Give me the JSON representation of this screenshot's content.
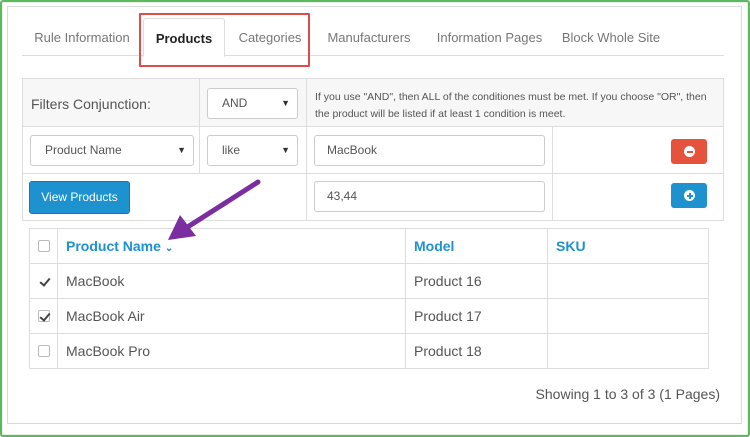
{
  "tabs": [
    {
      "label": "Rule Information",
      "active": false
    },
    {
      "label": "Products",
      "active": true
    },
    {
      "label": "Categories",
      "active": false
    },
    {
      "label": "Manufacturers",
      "active": false
    },
    {
      "label": "Information Pages",
      "active": false
    },
    {
      "label": "Block Whole Site",
      "active": false
    }
  ],
  "filters": {
    "conjunction_label": "Filters Conjunction:",
    "conjunction_value": "AND",
    "help_text": "If you use \"AND\", then ALL of the conditiones must be met. If you choose \"OR\", then the product will be listed if at least 1 condition is meet.",
    "field_value": "Product Name",
    "operator_value": "like",
    "value_input": "MacBook",
    "view_button": "View Products",
    "ids_input": "43,44"
  },
  "table": {
    "columns": [
      "Product Name",
      "Model",
      "SKU"
    ],
    "sort_column": "Product Name",
    "rows": [
      {
        "name": "MacBook",
        "model": "Product 16",
        "sku": "",
        "checked": true
      },
      {
        "name": "MacBook Air",
        "model": "Product 17",
        "sku": "",
        "checked": true
      },
      {
        "name": "MacBook Pro",
        "model": "Product 18",
        "sku": "",
        "checked": false
      }
    ]
  },
  "pagination": {
    "text": "Showing 1 to 3 of 3 (1 Pages)"
  },
  "colors": {
    "primary": "#1e91cf",
    "danger": "#e5533d",
    "highlight": "#e04b4b",
    "arrow": "#7a2ea0",
    "frame": "#5cb85c"
  },
  "icons": {
    "remove": "minus-circle-icon",
    "add": "plus-circle-icon",
    "sort": "chevron-down-icon",
    "select": "caret-down-icon"
  }
}
